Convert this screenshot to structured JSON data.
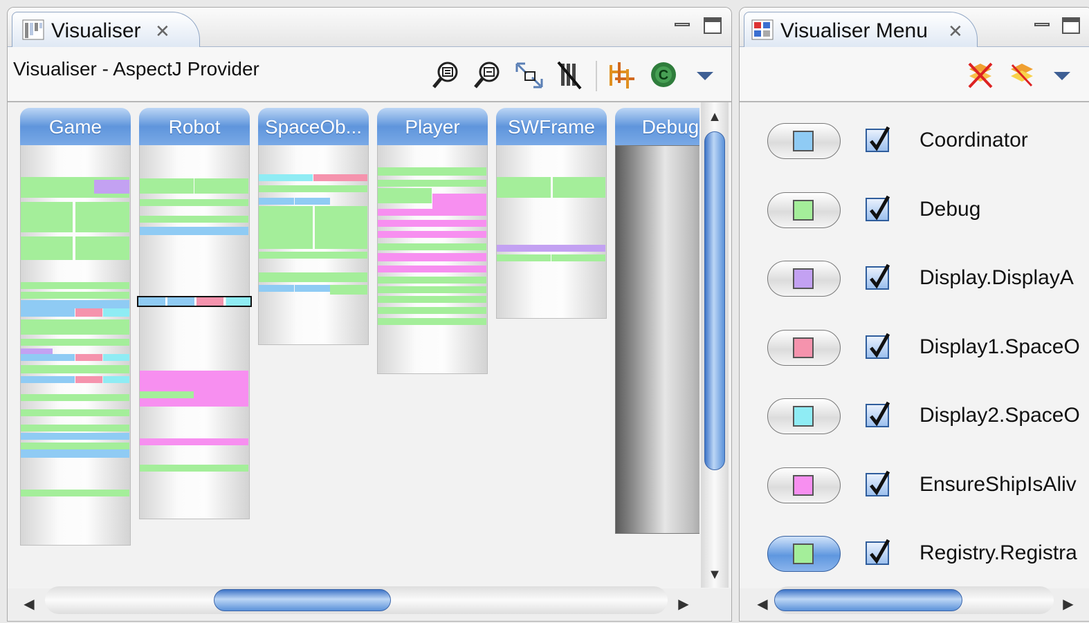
{
  "left_panel": {
    "tab_title": "Visualiser",
    "view_title": "Visualiser - AspectJ Provider",
    "toolbar_icons": [
      "zoom-in-icon",
      "zoom-out-icon",
      "fit-to-view-icon",
      "limit-view-icon",
      "group-view-icon",
      "apply-filter-icon",
      "view-menu-icon"
    ]
  },
  "right_panel": {
    "tab_title": "Visualiser Menu",
    "toolbar_icons": [
      "hide-unselected-icon",
      "show-all-icon",
      "view-menu-icon"
    ],
    "items": [
      {
        "label": "Coordinator",
        "color": "#8fcbf4",
        "checked": true,
        "active": false
      },
      {
        "label": "Debug",
        "color": "#a4ee9a",
        "checked": true,
        "active": false
      },
      {
        "label": "Display.DisplayA",
        "color": "#c3a1f2",
        "checked": true,
        "active": false
      },
      {
        "label": "Display1.SpaceO",
        "color": "#f593ad",
        "checked": true,
        "active": false
      },
      {
        "label": "Display2.SpaceO",
        "color": "#8fecf4",
        "checked": true,
        "active": false
      },
      {
        "label": "EnsureShipIsAliv",
        "color": "#f78ff0",
        "checked": true,
        "active": false
      },
      {
        "label": "Registry.Registra",
        "color": "#a4ee9a",
        "checked": true,
        "active": true
      }
    ]
  },
  "columns": [
    {
      "name": "Game",
      "height": 578,
      "stripes": [
        [
          100,
          30,
          0,
          1,
          "#a4ee9a"
        ],
        [
          100,
          30,
          0,
          0.48,
          "#a4ee9a"
        ],
        [
          100,
          22,
          0.48,
          0.52,
          "#a4ee9a"
        ],
        [
          104,
          20,
          0.67,
          0.33,
          "#c3a1f2"
        ],
        [
          136,
          44,
          0,
          0.48,
          "#a4ee9a"
        ],
        [
          136,
          44,
          0.5,
          0.5,
          "#a4ee9a"
        ],
        [
          186,
          34,
          0,
          0.48,
          "#a4ee9a"
        ],
        [
          186,
          34,
          0.5,
          0.5,
          "#a4ee9a"
        ],
        [
          252,
          10,
          0,
          1,
          "#a4ee9a"
        ],
        [
          266,
          10,
          0,
          1,
          "#a4ee9a"
        ],
        [
          278,
          12,
          0,
          1,
          "#8fcbf4"
        ],
        [
          290,
          12,
          0,
          0.5,
          "#8fcbf4"
        ],
        [
          290,
          12,
          0.5,
          0.25,
          "#f593ad"
        ],
        [
          290,
          12,
          0.75,
          0.25,
          "#8fecf4"
        ],
        [
          306,
          22,
          0,
          1,
          "#a4ee9a"
        ],
        [
          334,
          10,
          0,
          1,
          "#a4ee9a"
        ],
        [
          348,
          8,
          0,
          0.3,
          "#c3a1f2"
        ],
        [
          356,
          10,
          0,
          0.5,
          "#8fcbf4"
        ],
        [
          356,
          10,
          0.5,
          0.25,
          "#f593ad"
        ],
        [
          356,
          10,
          0.75,
          0.25,
          "#8fecf4"
        ],
        [
          372,
          12,
          0,
          1,
          "#a4ee9a"
        ],
        [
          388,
          10,
          0,
          0.5,
          "#8fcbf4"
        ],
        [
          388,
          10,
          0.5,
          0.25,
          "#f593ad"
        ],
        [
          388,
          10,
          0.75,
          0.25,
          "#8fecf4"
        ],
        [
          414,
          10,
          0,
          1,
          "#a4ee9a"
        ],
        [
          436,
          10,
          0,
          1,
          "#a4ee9a"
        ],
        [
          458,
          10,
          0,
          1,
          "#a4ee9a"
        ],
        [
          470,
          10,
          0,
          1,
          "#8fcbf4"
        ],
        [
          484,
          10,
          0,
          1,
          "#a4ee9a"
        ],
        [
          494,
          12,
          0,
          1,
          "#8fcbf4"
        ],
        [
          552,
          10,
          0,
          1,
          "#a4ee9a"
        ]
      ]
    },
    {
      "name": "Robot",
      "height": 540,
      "stripes": [
        [
          102,
          22,
          0,
          0.5,
          "#a4ee9a"
        ],
        [
          102,
          22,
          0.5,
          0.5,
          "#a4ee9a"
        ],
        [
          132,
          10,
          0,
          1,
          "#a4ee9a"
        ],
        [
          156,
          10,
          0,
          1,
          "#a4ee9a"
        ],
        [
          172,
          12,
          0,
          1,
          "#8fcbf4"
        ],
        [
          380,
          42,
          0,
          1,
          "#f78ff0"
        ],
        [
          410,
          10,
          0,
          0.5,
          "#a4ee9a"
        ],
        [
          422,
          10,
          0,
          1,
          "#f78ff0"
        ],
        [
          478,
          10,
          0,
          1,
          "#f78ff0"
        ],
        [
          516,
          10,
          0,
          1,
          "#a4ee9a"
        ]
      ],
      "highlight": [
        218,
        16
      ]
    },
    {
      "name": "SpaceOb...",
      "height": 288,
      "stripes": [
        [
          96,
          10,
          0,
          0.5,
          "#8fecf4"
        ],
        [
          96,
          10,
          0.5,
          0.5,
          "#f593ad"
        ],
        [
          112,
          10,
          0,
          1,
          "#a4ee9a"
        ],
        [
          130,
          10,
          0,
          0.33,
          "#8fcbf4"
        ],
        [
          130,
          10,
          0.33,
          0.33,
          "#8fcbf4"
        ],
        [
          142,
          62,
          0,
          0.5,
          "#a4ee9a"
        ],
        [
          142,
          62,
          0.51,
          0.49,
          "#a4ee9a"
        ],
        [
          208,
          10,
          0,
          1,
          "#a4ee9a"
        ],
        [
          238,
          14,
          0,
          1,
          "#a4ee9a"
        ],
        [
          256,
          14,
          0.65,
          0.35,
          "#a4ee9a"
        ],
        [
          256,
          10,
          0,
          0.33,
          "#8fcbf4"
        ],
        [
          256,
          10,
          0.33,
          0.33,
          "#8fcbf4"
        ]
      ]
    },
    {
      "name": "Player",
      "height": 330,
      "stripes": [
        [
          86,
          12,
          0,
          1,
          "#a4ee9a"
        ],
        [
          104,
          10,
          0,
          1,
          "#a4ee9a"
        ],
        [
          116,
          22,
          0,
          0.5,
          "#a4ee9a"
        ],
        [
          124,
          22,
          0.5,
          0.5,
          "#f78ff0"
        ],
        [
          146,
          10,
          0,
          1,
          "#f78ff0"
        ],
        [
          162,
          10,
          0,
          1,
          "#f78ff0"
        ],
        [
          178,
          10,
          0,
          1,
          "#f78ff0"
        ],
        [
          196,
          10,
          0,
          1,
          "#a4ee9a"
        ],
        [
          210,
          12,
          0,
          1,
          "#f78ff0"
        ],
        [
          228,
          10,
          0,
          1,
          "#f78ff0"
        ],
        [
          244,
          10,
          0,
          1,
          "#a4ee9a"
        ],
        [
          258,
          10,
          0,
          1,
          "#a4ee9a"
        ],
        [
          272,
          10,
          0,
          1,
          "#a4ee9a"
        ],
        [
          288,
          10,
          0,
          1,
          "#a4ee9a"
        ],
        [
          304,
          10,
          0,
          1,
          "#a4ee9a"
        ]
      ]
    },
    {
      "name": "SWFrame",
      "height": 250,
      "stripes": [
        [
          100,
          30,
          0,
          0.5,
          "#a4ee9a"
        ],
        [
          100,
          30,
          0.51,
          0.49,
          "#a4ee9a"
        ],
        [
          198,
          10,
          0,
          1,
          "#c3a1f2"
        ],
        [
          212,
          10,
          0,
          0.5,
          "#a4ee9a"
        ],
        [
          212,
          10,
          0.5,
          0.5,
          "#a4ee9a"
        ]
      ]
    },
    {
      "name": "Debug",
      "height": 560,
      "stripes": [],
      "dark": true
    }
  ]
}
